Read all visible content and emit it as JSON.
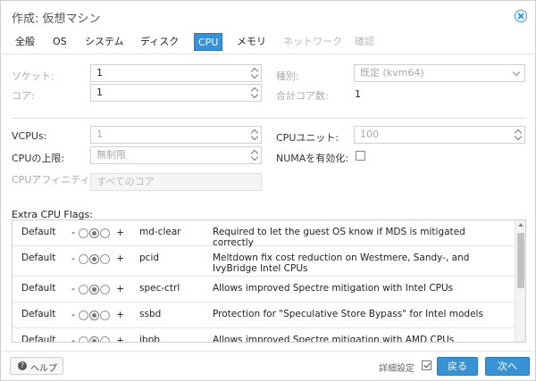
{
  "dialog": {
    "title": "作成: 仮想マシン",
    "close_icon": "close-circle-icon"
  },
  "tabs": [
    {
      "label": "全般",
      "state": "normal"
    },
    {
      "label": "OS",
      "state": "normal"
    },
    {
      "label": "システム",
      "state": "normal"
    },
    {
      "label": "ディスク",
      "state": "normal"
    },
    {
      "label": "CPU",
      "state": "active"
    },
    {
      "label": "メモリ",
      "state": "normal"
    },
    {
      "label": "ネットワーク",
      "state": "disabled"
    },
    {
      "label": "確認",
      "state": "disabled"
    }
  ],
  "form": {
    "sockets_label": "ソケット:",
    "sockets_value": "1",
    "cores_label": "コア:",
    "cores_value": "1",
    "type_label": "種別:",
    "type_value": "既定 (kvm64)",
    "total_cores_label": "合計コア数:",
    "total_cores_value": "1",
    "vcpus_label": "VCPUs:",
    "vcpus_value": "1",
    "cpu_limit_label": "CPUの上限:",
    "cpu_limit_value": "無制限",
    "cpu_units_label": "CPUユニット:",
    "cpu_units_value": "100",
    "numa_label": "NUMAを有効化:",
    "affinity_label": "CPUアフィニティ:",
    "affinity_placeholder": "すべてのコア"
  },
  "flags": {
    "title": "Extra CPU Flags:",
    "minus": "-",
    "plus": "+",
    "rows": [
      {
        "default": "Default",
        "name": "md-clear",
        "description": "Required to let the guest OS know if MDS is mitigated correctly"
      },
      {
        "default": "Default",
        "name": "pcid",
        "description": "Meltdown fix cost reduction on Westmere, Sandy-, and IvyBridge Intel CPUs"
      },
      {
        "default": "Default",
        "name": "spec-ctrl",
        "description": "Allows improved Spectre mitigation with Intel CPUs"
      },
      {
        "default": "Default",
        "name": "ssbd",
        "description": "Protection for \"Speculative Store Bypass\" for Intel models"
      },
      {
        "default": "Default",
        "name": "ibpb",
        "description": "Allows improved Spectre mitigation with AMD CPUs"
      }
    ]
  },
  "footer": {
    "help_label": "ヘルプ",
    "help_icon_glyph": "?",
    "advanced_label": "詳細設定",
    "back_label": "戻る",
    "next_label": "次へ"
  },
  "colors": {
    "accent": "#3892d4"
  }
}
